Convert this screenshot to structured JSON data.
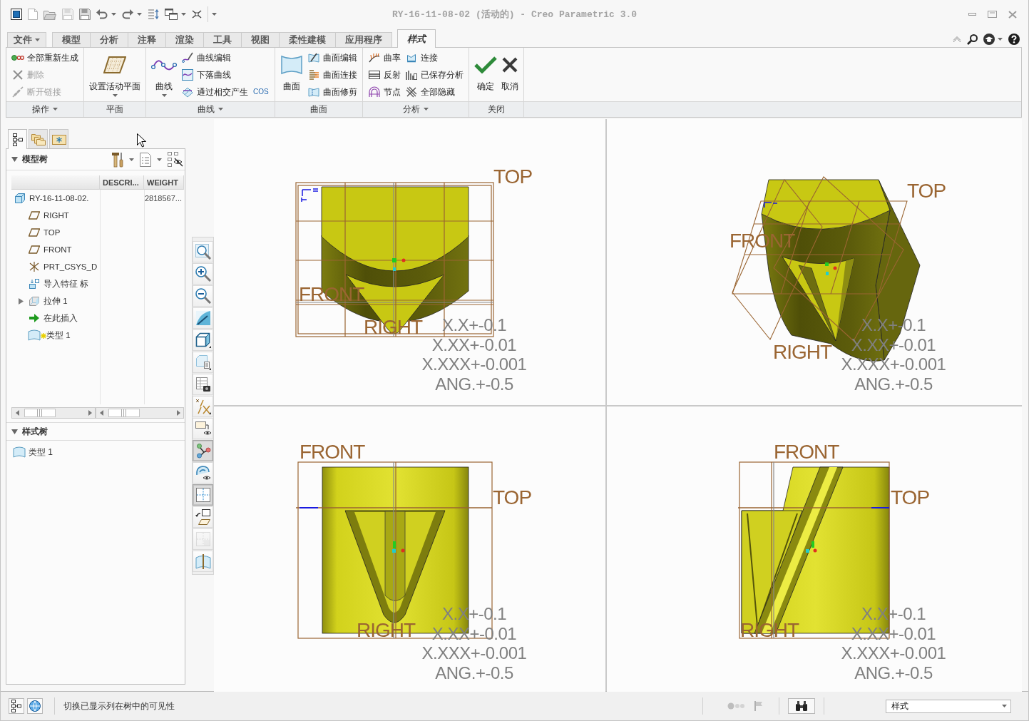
{
  "title_bar": {
    "title": "RY-16-11-08-02 (活动的) - Creo Parametric 3.0"
  },
  "ribbon_tabs": [
    {
      "label": "文件",
      "kind": "menu",
      "selected": false
    },
    {
      "label": "模型",
      "kind": "tab",
      "selected": false
    },
    {
      "label": "分析",
      "kind": "tab",
      "selected": false
    },
    {
      "label": "注释",
      "kind": "tab",
      "selected": false
    },
    {
      "label": "渲染",
      "kind": "tab",
      "selected": false
    },
    {
      "label": "工具",
      "kind": "tab",
      "selected": false
    },
    {
      "label": "视图",
      "kind": "tab",
      "selected": false
    },
    {
      "label": "柔性建模",
      "kind": "tab",
      "selected": false
    },
    {
      "label": "应用程序",
      "kind": "tab",
      "selected": false
    },
    {
      "label": "样式",
      "kind": "tab",
      "selected": true
    }
  ],
  "ribbon_groups": [
    {
      "label": "操作",
      "dropdown": true,
      "columns": [
        [
          {
            "label": "全部重新生成",
            "kind": "small",
            "disabled": false
          },
          {
            "label": "删除",
            "kind": "small",
            "disabled": true
          },
          {
            "label": "断开链接",
            "kind": "small",
            "disabled": true
          }
        ]
      ]
    },
    {
      "label": "平面",
      "dropdown": false,
      "columns": [
        [
          {
            "label": "设置活动平面",
            "kind": "large",
            "caret": true,
            "disabled": false
          }
        ]
      ]
    },
    {
      "label": "曲线",
      "dropdown": true,
      "columns": [
        [
          {
            "label": "曲线",
            "kind": "large",
            "caret": true,
            "disabled": false
          }
        ],
        [
          {
            "label": "曲线编辑",
            "kind": "small",
            "disabled": false
          },
          {
            "label": "下落曲线",
            "kind": "small",
            "disabled": false
          },
          {
            "label": "通过相交产生",
            "kind": "small",
            "disabled": false
          }
        ],
        [
          {
            "label": "COS",
            "kind": "mini",
            "disabled": false
          }
        ]
      ]
    },
    {
      "label": "曲面",
      "dropdown": false,
      "columns": [
        [
          {
            "label": "曲面",
            "kind": "large",
            "caret": false,
            "disabled": false
          }
        ],
        [
          {
            "label": "曲面编辑",
            "kind": "small",
            "disabled": false
          },
          {
            "label": "曲面连接",
            "kind": "small",
            "disabled": false
          },
          {
            "label": "曲面修剪",
            "kind": "small",
            "disabled": false
          }
        ]
      ]
    },
    {
      "label": "分析",
      "dropdown": true,
      "columns": [
        [
          {
            "label": "曲率",
            "kind": "small",
            "disabled": false
          },
          {
            "label": "反射",
            "kind": "small",
            "disabled": false
          },
          {
            "label": "节点",
            "kind": "small",
            "disabled": false
          }
        ],
        [
          {
            "label": "连接",
            "kind": "small",
            "disabled": false
          },
          {
            "label": "已保存分析",
            "kind": "small",
            "disabled": false
          },
          {
            "label": "全部隐藏",
            "kind": "small",
            "disabled": false
          }
        ]
      ]
    },
    {
      "label": "关闭",
      "dropdown": false,
      "columns": [
        [
          {
            "label": "确定",
            "kind": "large",
            "caret": false,
            "disabled": false
          }
        ],
        [
          {
            "label": "取消",
            "kind": "large",
            "caret": false,
            "disabled": false
          }
        ]
      ]
    }
  ],
  "navigator": {
    "tabs": [
      {
        "selected": true
      },
      {
        "selected": false
      },
      {
        "selected": false
      }
    ],
    "model_tree": {
      "title": "模型树",
      "expanded": true,
      "columns": [
        "DESCRI...",
        "WEIGHT"
      ],
      "items": [
        {
          "label": "RY-16-11-08-02.",
          "kind": "part",
          "weight": "2818567...",
          "collapsed": false,
          "new": false,
          "children": [
            {
              "label": "RIGHT",
              "kind": "datum_plane",
              "collapsed": false,
              "new": false
            },
            {
              "label": "TOP",
              "kind": "datum_plane",
              "collapsed": false,
              "new": false
            },
            {
              "label": "FRONT",
              "kind": "datum_plane",
              "collapsed": false,
              "new": false
            },
            {
              "label": "PRT_CSYS_D",
              "kind": "csys",
              "collapsed": false,
              "new": false
            },
            {
              "label": "导入特征 标",
              "kind": "import",
              "collapsed": false,
              "new": false
            },
            {
              "label": "拉伸 1",
              "kind": "extrude",
              "collapsed": true,
              "new": false
            },
            {
              "label": "在此插入",
              "kind": "insert",
              "collapsed": false,
              "new": false
            },
            {
              "label": "类型 1",
              "kind": "style",
              "collapsed": false,
              "new": true
            }
          ]
        }
      ]
    },
    "style_tree": {
      "title": "样式树",
      "expanded": true,
      "items": [
        {
          "label": "类型 1",
          "kind": "style"
        }
      ]
    }
  },
  "view_toolbar": [
    {
      "on": false,
      "disabled": false
    },
    {
      "on": false,
      "disabled": false
    },
    {
      "on": false,
      "disabled": false
    },
    {
      "on": false,
      "disabled": false
    },
    {
      "on": false,
      "disabled": false
    },
    {
      "on": false,
      "disabled": false
    },
    {
      "on": false,
      "disabled": false
    },
    {
      "on": false,
      "disabled": false
    },
    {
      "on": false,
      "disabled": false
    },
    {
      "on": true,
      "disabled": false
    },
    {
      "on": false,
      "disabled": false
    },
    {
      "on": true,
      "disabled": false
    },
    {
      "on": false,
      "disabled": false
    },
    {
      "on": false,
      "disabled": true
    },
    {
      "on": false,
      "disabled": false
    }
  ],
  "viewports": [
    {
      "kind": "top",
      "datum_labels": [
        "TOP",
        "FRONT",
        "RIGHT"
      ],
      "tolerances": [
        "X.X+-0.1",
        "X.XX+-0.01",
        "X.XXX+-0.001",
        "ANG.+-0.5"
      ]
    },
    {
      "kind": "iso",
      "datum_labels": [
        "TOP",
        "FRONT",
        "RIGHT"
      ],
      "tolerances": [
        "X.X+-0.1",
        "X.XX+-0.01",
        "X.XXX+-0.001",
        "ANG.+-0.5"
      ]
    },
    {
      "kind": "front",
      "datum_labels": [
        "FRONT",
        "TOP",
        "RIGHT"
      ],
      "tolerances": [
        "X.X+-0.1",
        "X.XX+-0.01",
        "X.XXX+-0.001",
        "ANG.+-0.5"
      ]
    },
    {
      "kind": "side",
      "datum_labels": [
        "FRONT",
        "TOP",
        "RIGHT"
      ],
      "tolerances": [
        "X.X+-0.1",
        "X.XX+-0.01",
        "X.XXX+-0.001",
        "ANG.+-0.5"
      ]
    }
  ],
  "status_bar": {
    "message": "切换已显示列在树中的可见性",
    "filter": {
      "value": "样式"
    }
  }
}
